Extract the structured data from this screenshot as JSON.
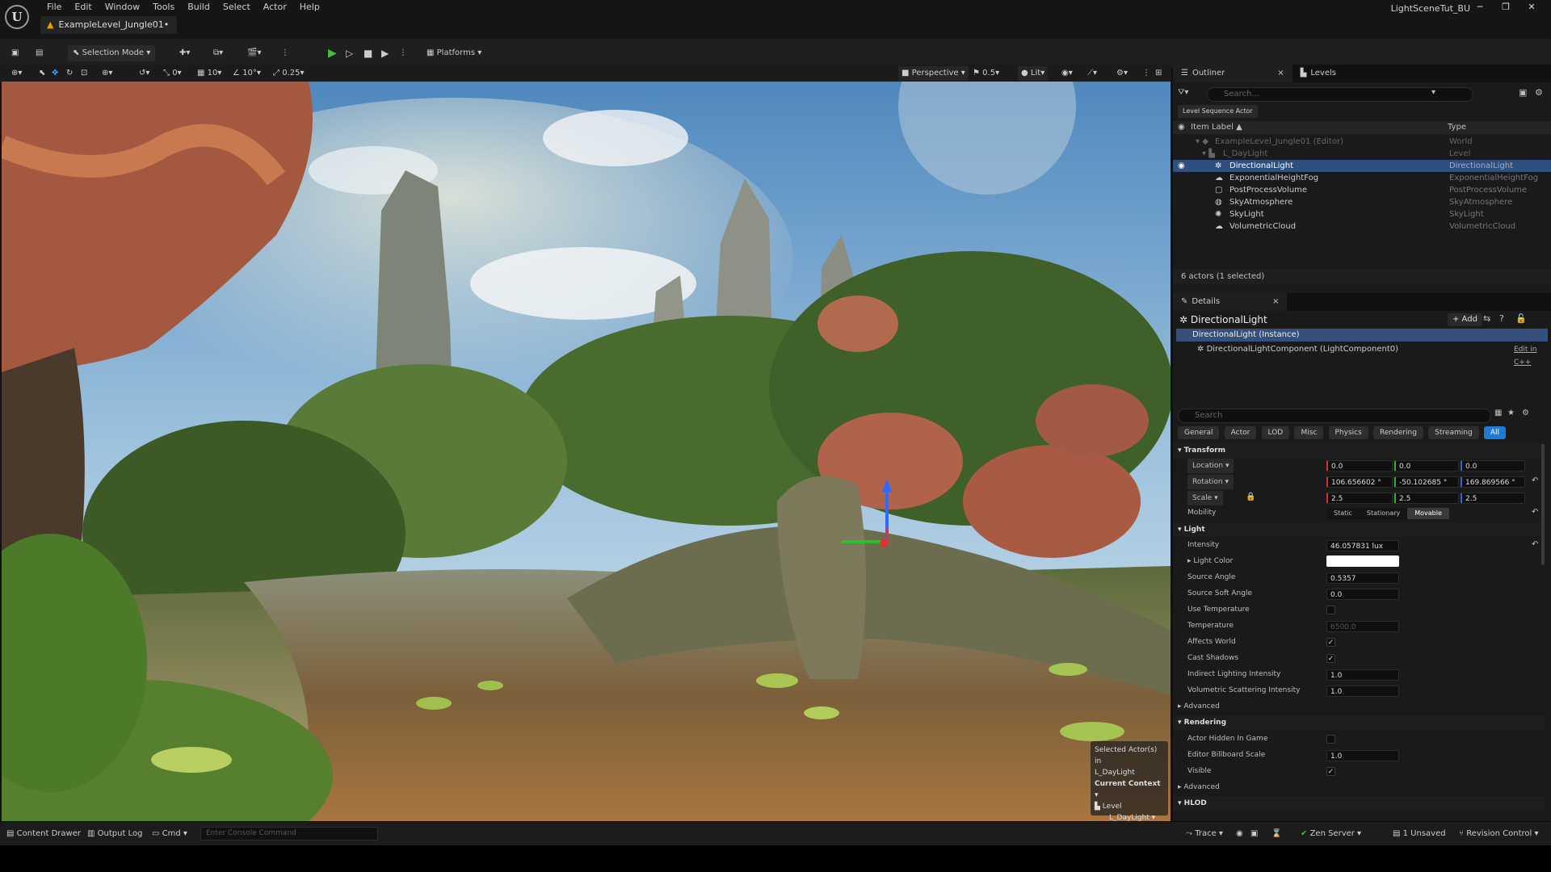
{
  "app": {
    "logo": "U",
    "menu": [
      "File",
      "Edit",
      "Window",
      "Tools",
      "Build",
      "Select",
      "Actor",
      "Help"
    ],
    "level_tab": "ExampleLevel_Jungle01•",
    "project_name": "LightSceneTut_BU",
    "window_controls": [
      "─",
      "❐",
      "✕"
    ]
  },
  "toolbar": {
    "selection_mode": "Selection Mode",
    "platforms": "Platforms"
  },
  "viewport_bar": {
    "snap_move": "0",
    "grid": "10",
    "rotate": "10°",
    "scale": "0.25",
    "view_mode": "Perspective",
    "camera_speed": "0.5",
    "lighting": "Lit"
  },
  "viewport_context": {
    "selected_line1": "Selected Actor(s) in",
    "selected_line2": "L_DayLight",
    "current_context": "Current Context",
    "level": "Level",
    "level_name": "L_DayLight"
  },
  "outliner": {
    "tab_outliner": "Outliner",
    "tab_levels": "Levels",
    "search_placeholder": "Search...",
    "filter_chip": "Level Sequence Actor",
    "col_label": "Item Label ▲",
    "col_type": "Type",
    "rows": [
      {
        "label": "ExampleLevel_Jungle01 (Editor)",
        "type": "World"
      },
      {
        "label": "L_DayLight",
        "type": "Level"
      },
      {
        "label": "DirectionalLight",
        "type": "DirectionalLight"
      },
      {
        "label": "ExponentialHeightFog",
        "type": "ExponentialHeightFog"
      },
      {
        "label": "PostProcessVolume",
        "type": "PostProcessVolume"
      },
      {
        "label": "SkyAtmosphere",
        "type": "SkyAtmosphere"
      },
      {
        "label": "SkyLight",
        "type": "SkyLight"
      },
      {
        "label": "VolumetricCloud",
        "type": "VolumetricCloud"
      }
    ],
    "footer": "6 actors (1 selected)"
  },
  "details": {
    "tab": "Details",
    "actor_name": "DirectionalLight",
    "add_button": "+ Add",
    "instance": "DirectionalLight (Instance)",
    "component": "DirectionalLightComponent (LightComponent0)",
    "edit_cpp": "Edit in C++",
    "search_placeholder": "Search",
    "filters": [
      "General",
      "Actor",
      "LOD",
      "Misc",
      "Physics",
      "Rendering",
      "Streaming",
      "All"
    ],
    "transform": {
      "title": "Transform",
      "location_label": "Location",
      "location": [
        "0.0",
        "0.0",
        "0.0"
      ],
      "rotation_label": "Rotation",
      "rotation": [
        "106.656602 °",
        "-50.102685 °",
        "169.869566 °"
      ],
      "scale_label": "Scale",
      "scale": [
        "2.5",
        "2.5",
        "2.5"
      ],
      "mobility_label": "Mobility",
      "mobility": [
        "Static",
        "Stationary",
        "Movable"
      ]
    },
    "light": {
      "title": "Light",
      "intensity_label": "Intensity",
      "intensity": "46.057831 lux",
      "light_color_label": "Light Color",
      "source_angle_label": "Source Angle",
      "source_angle": "0.5357",
      "source_soft_angle_label": "Source Soft Angle",
      "source_soft_angle": "0.0",
      "use_temperature_label": "Use Temperature",
      "temperature_label": "Temperature",
      "temperature": "6500.0",
      "affects_world_label": "Affects World",
      "cast_shadows_label": "Cast Shadows",
      "indirect_label": "Indirect Lighting Intensity",
      "indirect": "1.0",
      "volumetric_label": "Volumetric Scattering Intensity",
      "volumetric": "1.0",
      "advanced": "Advanced"
    },
    "rendering": {
      "title": "Rendering",
      "hidden_label": "Actor Hidden In Game",
      "billboard_label": "Editor Billboard Scale",
      "billboard": "1.0",
      "visible_label": "Visible",
      "advanced": "Advanced"
    },
    "hlod_title": "HLOD"
  },
  "statusbar": {
    "content_drawer": "Content Drawer",
    "output_log": "Output Log",
    "cmd": "Cmd",
    "console_placeholder": "Enter Console Command",
    "trace": "Trace",
    "zen_server": "Zen Server",
    "unsaved": "1 Unsaved",
    "revision_control": "Revision Control"
  },
  "colors": {
    "selection": "#2f4f7f",
    "accent_blue": "#1f7ad6",
    "play_green": "#3fbf3f"
  }
}
